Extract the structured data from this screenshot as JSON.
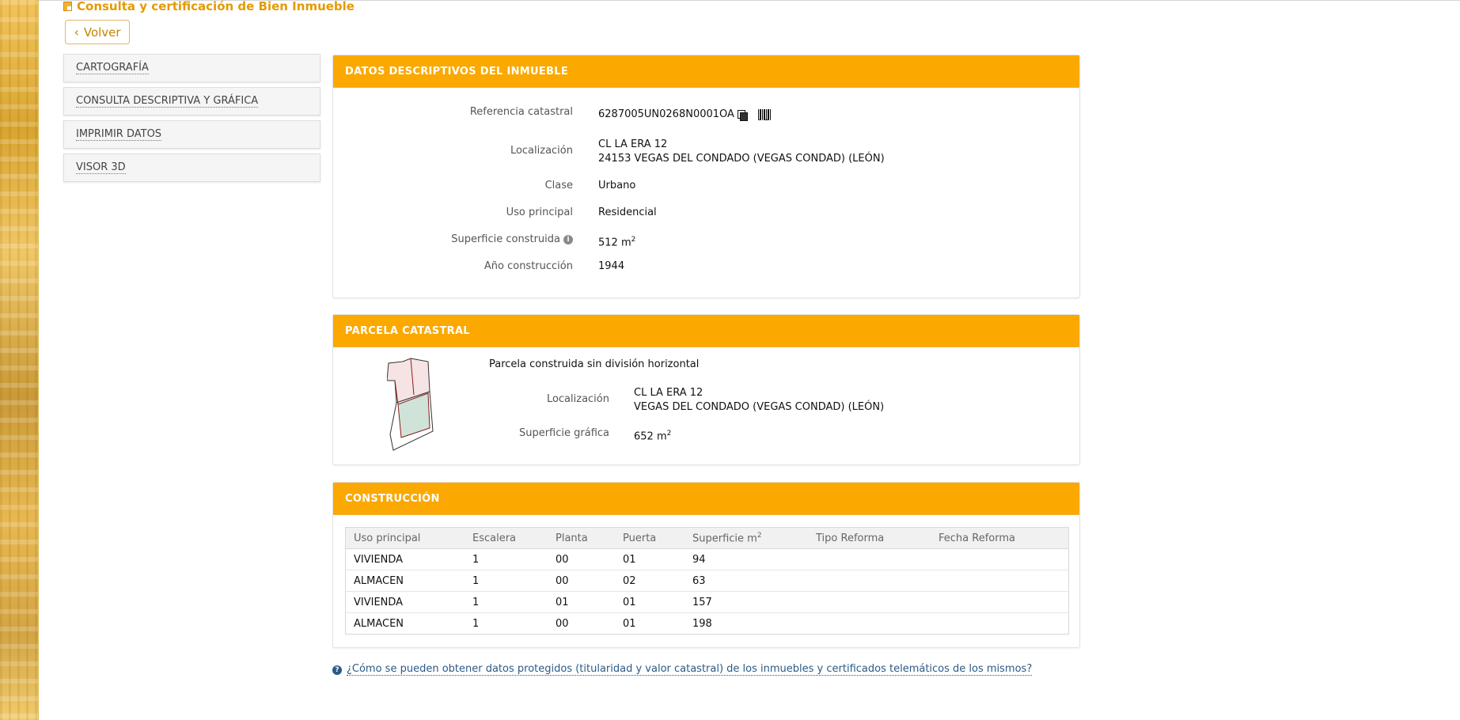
{
  "page": {
    "title": "Consulta y certificación de Bien Inmueble",
    "back_label": "Volver"
  },
  "sidebar": {
    "items": [
      {
        "label": "CARTOGRAFÍA"
      },
      {
        "label": "CONSULTA DESCRIPTIVA Y GRÁFICA"
      },
      {
        "label": "IMPRIMIR DATOS"
      },
      {
        "label": "VISOR 3D"
      }
    ]
  },
  "datos": {
    "header": "DATOS DESCRIPTIVOS DEL INMUEBLE",
    "referencia_label": "Referencia catastral",
    "referencia_value": "6287005UN0268N0001OA",
    "localizacion_label": "Localización",
    "localizacion_line1": "CL LA ERA 12",
    "localizacion_line2": "24153 VEGAS DEL CONDADO (VEGAS CONDAD) (LEÓN)",
    "clase_label": "Clase",
    "clase_value": "Urbano",
    "uso_label": "Uso principal",
    "uso_value": "Residencial",
    "superficie_label": "Superficie construida",
    "superficie_value": "512 m",
    "superficie_unit_exp": "2",
    "anio_label": "Año construcción",
    "anio_value": "1944"
  },
  "parcela": {
    "header": "PARCELA CATASTRAL",
    "descripcion": "Parcela construida sin división horizontal",
    "localizacion_label": "Localización",
    "localizacion_line1": "CL LA ERA 12",
    "localizacion_line2": "VEGAS DEL CONDADO (VEGAS CONDAD) (LEÓN)",
    "superficie_label": "Superficie gráfica",
    "superficie_value": "652 m",
    "superficie_unit_exp": "2"
  },
  "construccion": {
    "header": "CONSTRUCCIÓN",
    "columns": [
      "Uso principal",
      "Escalera",
      "Planta",
      "Puerta",
      "Superficie m",
      "Tipo Reforma",
      "Fecha Reforma"
    ],
    "superficie_col_exp": "2",
    "rows": [
      [
        "VIVIENDA",
        "1",
        "00",
        "01",
        "94",
        "",
        ""
      ],
      [
        "ALMACEN",
        "1",
        "00",
        "02",
        "63",
        "",
        ""
      ],
      [
        "VIVIENDA",
        "1",
        "01",
        "01",
        "157",
        "",
        ""
      ],
      [
        "ALMACEN",
        "1",
        "00",
        "01",
        "198",
        "",
        ""
      ]
    ]
  },
  "help": {
    "link_text": "¿Cómo se pueden obtener datos protegidos (titularidad y valor catastral) de los inmuebles y certificados telemáticos de los mismos?"
  },
  "colors": {
    "header_orange": "#fba800",
    "title_orange": "#e49a00",
    "link_blue": "#2a5a86"
  }
}
